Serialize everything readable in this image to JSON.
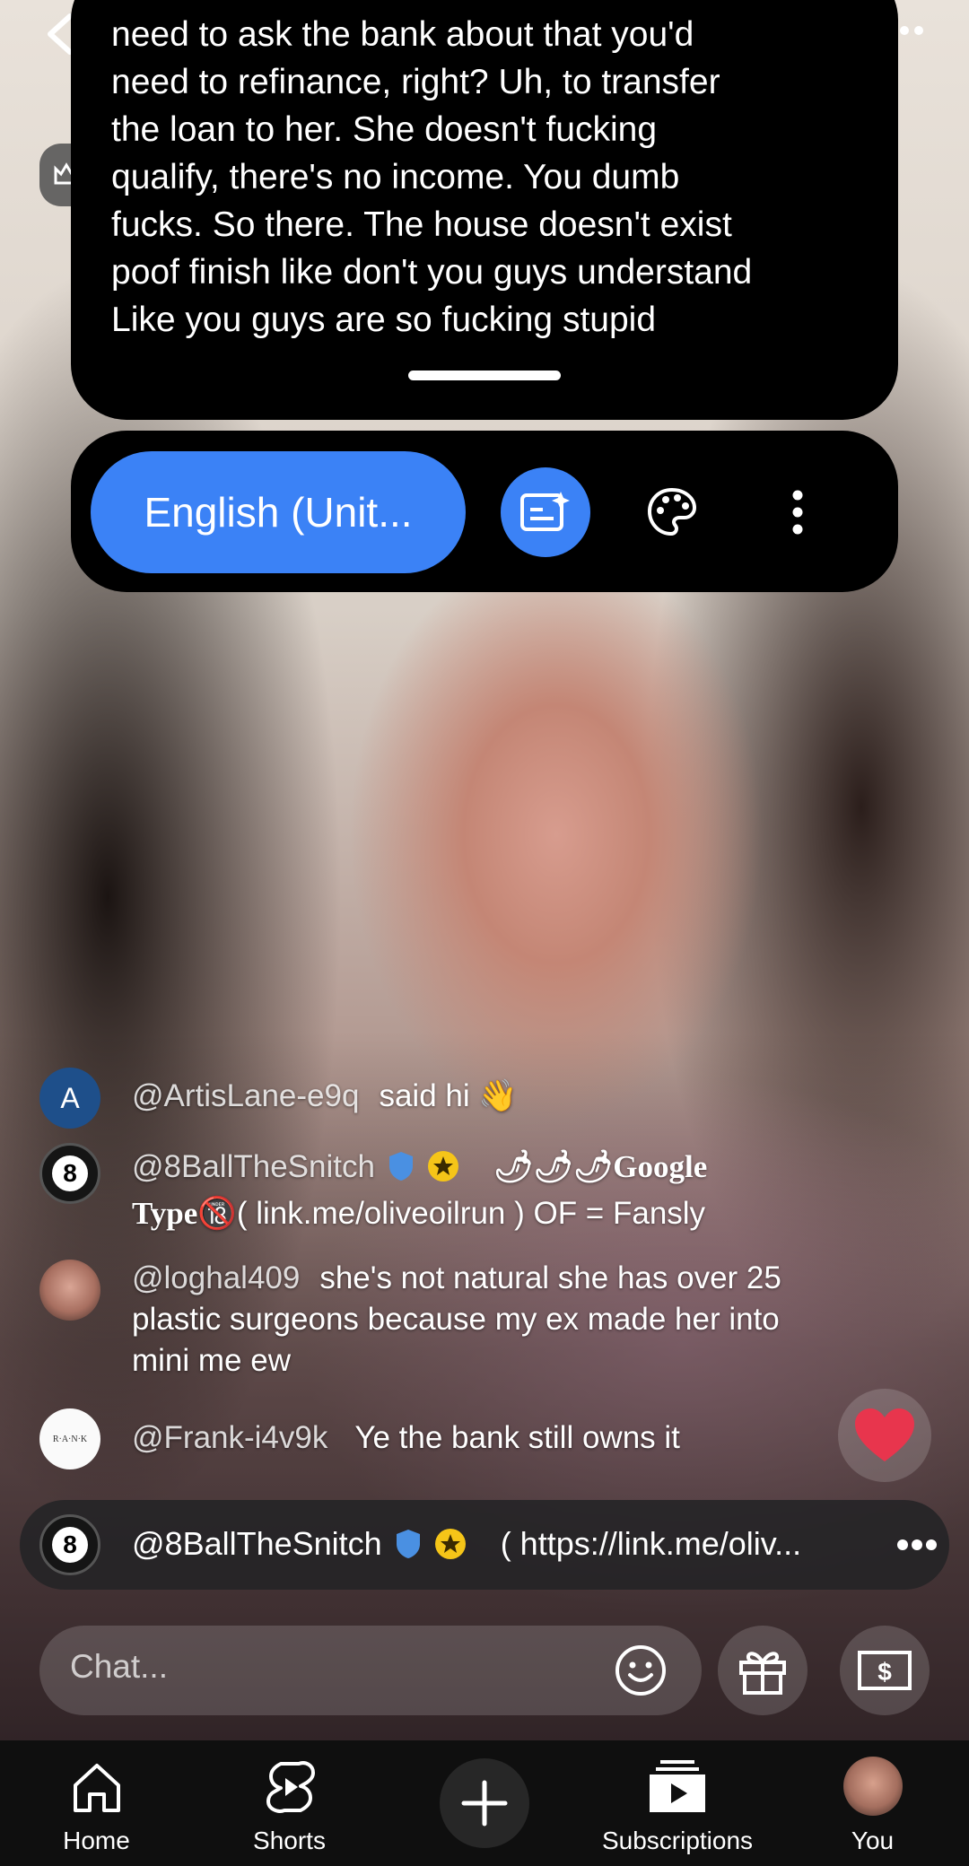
{
  "caption": {
    "text": "need to ask the bank about that you'd\nneed to refinance, right? Uh, to transfer\nthe loan to her. She doesn't fucking\nqualify, there's no income. You dumb\nfucks. So there. The house doesn't exist\npoof finish like don't you guys understand\nLike you guys are so fucking stupid"
  },
  "caption_toolbar": {
    "language": "English (Unit...",
    "icons": [
      "ai-caption-icon",
      "palette-icon",
      "more-vertical-icon"
    ]
  },
  "chat": {
    "messages": [
      {
        "avatar_letter": "A",
        "avatar_color": "#1e4f8a",
        "author": "@ArtisLane-e9q",
        "text": "said hi 👋"
      },
      {
        "avatar_letter": "8",
        "author": "@8BallTheSnitch",
        "text_prefix": "🌶🌶🌶Google",
        "text_line2_a": "Type",
        "text_line2_b": "🔞( link.me/oliveoilrun ) OF = Fansly"
      },
      {
        "author": "@loghal409",
        "text": "she's not natural she has over 25 plastic surgeons because my ex made her into mini me ew"
      },
      {
        "avatar_letter": "R·A·N·K",
        "author": "@Frank-i4v9k",
        "text": "Ye the bank still owns it"
      }
    ],
    "pinned": {
      "avatar_letter": "8",
      "author": "@8BallTheSnitch",
      "text": "( https://link.me/oliv..."
    },
    "input": {
      "placeholder": "Chat..."
    }
  },
  "colors": {
    "accent": "#3b82f6",
    "verified": "#4a90e2",
    "star": "#f5c518",
    "heart": "#e8354d"
  },
  "nav": {
    "items": [
      {
        "label": "Home",
        "icon": "home-icon"
      },
      {
        "label": "Shorts",
        "icon": "shorts-icon"
      },
      {
        "label": "",
        "icon": "create-plus-icon"
      },
      {
        "label": "Subscriptions",
        "icon": "subscriptions-icon"
      },
      {
        "label": "You",
        "icon": "avatar"
      }
    ]
  }
}
